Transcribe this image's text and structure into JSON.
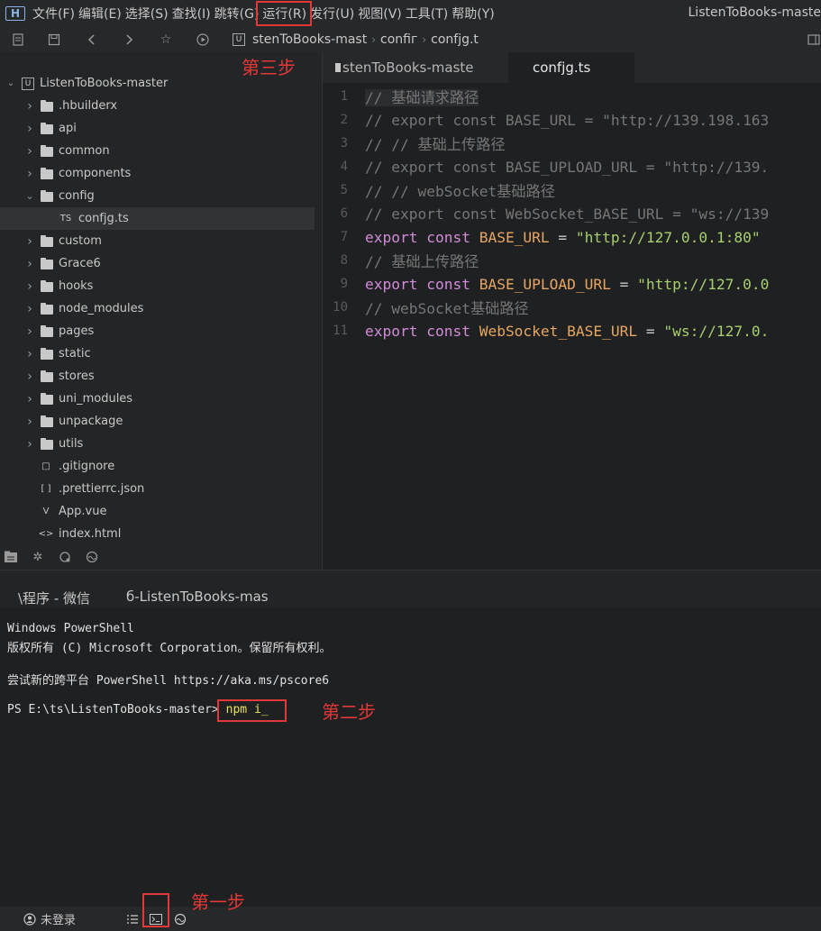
{
  "menubar": {
    "items": [
      "文件(F)",
      "编辑(E)",
      "选择(S)",
      "查找(I)",
      "跳转(G)",
      "运行(R)",
      "发行(U)",
      "视图(V)",
      "工具(T)",
      "帮助(Y)"
    ],
    "window_title": "ListenToBooks-maste"
  },
  "toolbar": {
    "breadcrumb": [
      "ListenToBooks-mast",
      "config",
      "config.ts"
    ],
    "breadcrumb_visible": [
      "stenToBooks-mast",
      "confiг",
      "confjg.t"
    ]
  },
  "sidebar": {
    "project": "ListenToBooks-master",
    "items": [
      {
        "label": ".hbuilderx",
        "type": "folder"
      },
      {
        "label": "api",
        "type": "folder"
      },
      {
        "label": "common",
        "type": "folder"
      },
      {
        "label": "components",
        "type": "folder"
      },
      {
        "label": "config",
        "type": "folder-open"
      },
      {
        "label": "confjg.ts",
        "type": "file",
        "badge": "TS"
      },
      {
        "label": "custom",
        "type": "folder"
      },
      {
        "label": "Grace6",
        "type": "folder"
      },
      {
        "label": "hooks",
        "type": "folder"
      },
      {
        "label": "node_modules",
        "type": "folder"
      },
      {
        "label": "pages",
        "type": "folder"
      },
      {
        "label": "static",
        "type": "folder"
      },
      {
        "label": "stores",
        "type": "folder"
      },
      {
        "label": "uni_modules",
        "type": "folder"
      },
      {
        "label": "unpackage",
        "type": "folder"
      },
      {
        "label": "utils",
        "type": "folder"
      },
      {
        "label": ".gitignore",
        "type": "file",
        "badge": "□"
      },
      {
        "label": ".prettierrc.json",
        "type": "file",
        "badge": "[ ]"
      },
      {
        "label": "App.vue",
        "type": "file",
        "badge": "V"
      },
      {
        "label": "index.html",
        "type": "file",
        "badge": "<>"
      }
    ]
  },
  "editor": {
    "tabs": [
      "stenToBooks-maste",
      "confjg.ts"
    ],
    "lines": [
      [
        [
          "c-comment",
          "// 基础请求路径"
        ]
      ],
      [
        [
          "c-comment",
          "// export const BASE_URL = \"http://139.198.163"
        ]
      ],
      [
        [
          "c-comment",
          "// // 基础上传路径"
        ]
      ],
      [
        [
          "c-comment",
          "// export const BASE_UPLOAD_URL = \"http://139."
        ]
      ],
      [
        [
          "c-comment",
          "// // webSocket基础路径"
        ]
      ],
      [
        [
          "c-comment",
          "// export const WebSocket_BASE_URL = \"ws://139"
        ]
      ],
      [
        [
          "c-kw",
          "export const "
        ],
        [
          "c-var",
          "BASE_URL"
        ],
        [
          "c-op",
          " = "
        ],
        [
          "c-str",
          "\"http://127.0.0.1:80\""
        ]
      ],
      [
        [
          "c-comment",
          "// 基础上传路径"
        ]
      ],
      [
        [
          "c-kw",
          "export const "
        ],
        [
          "c-var",
          "BASE_UPLOAD_URL"
        ],
        [
          "c-op",
          " = "
        ],
        [
          "c-str",
          "\"http://127.0.0"
        ]
      ],
      [
        [
          "c-comment",
          "// webSocket基础路径"
        ]
      ],
      [
        [
          "c-kw",
          "export const "
        ],
        [
          "c-var",
          "WebSocket_BASE_URL"
        ],
        [
          "c-op",
          " = "
        ],
        [
          "c-str",
          "\"ws://127.0."
        ]
      ]
    ]
  },
  "terminal": {
    "tabs": [
      "\\程序 - 微信",
      "б-ListenToBooks-mas"
    ],
    "lines": [
      "Windows PowerShell",
      "版权所有 (C) Microsoft Corporation。保留所有权利。",
      "",
      "尝试新的跨平台 PowerShell https://aka.ms/pscore6",
      ""
    ],
    "prompt": "PS E:\\ts\\ListenToBooks-master> ",
    "command": "npm i_"
  },
  "statusbar": {
    "login": "未登录"
  },
  "annotations": {
    "step1": "第一步",
    "step2": "第二步",
    "step3": "第三步"
  }
}
